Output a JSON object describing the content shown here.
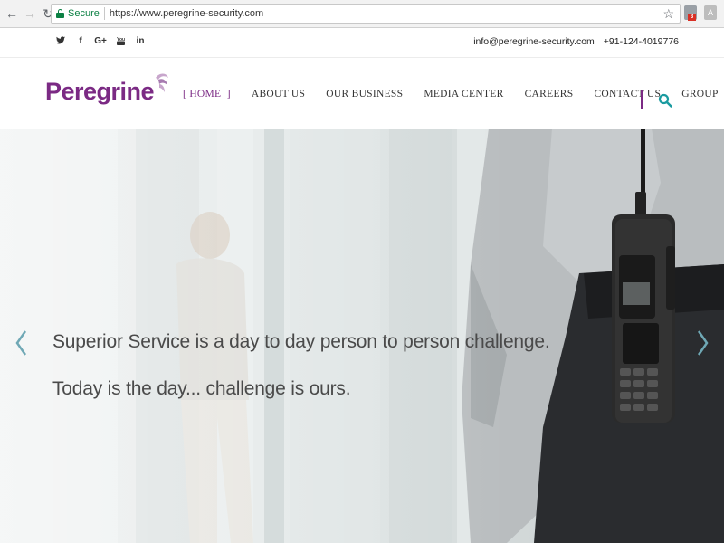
{
  "browser": {
    "secure_label": "Secure",
    "url": "https://www.peregrine-security.com",
    "mail_badge": "3",
    "pdf_label": "A"
  },
  "social": [
    "twitter-icon",
    "facebook-icon",
    "google-plus-icon",
    "youtube-icon",
    "linkedin-icon"
  ],
  "social_glyphs": [
    "𝕥",
    "f",
    "G+",
    "▶",
    "in"
  ],
  "contact": {
    "email": "info@peregrine-security.com",
    "phone": "+91-124-4019776"
  },
  "logo": {
    "text": "Peregrine"
  },
  "nav": {
    "home": "HOME",
    "about": "ABOUT US",
    "business": "OUR BUSINESS",
    "media": "MEDIA CENTER",
    "careers": "CAREERS",
    "contact": "CONTACT US",
    "group": "GROUP"
  },
  "hero": {
    "line1": "Superior Service is a day to day person to person challenge.",
    "line2": "Today is the day... challenge is ours."
  },
  "colors": {
    "brand": "#7b2a84",
    "accent": "#1a9ba0",
    "secure": "#0b8043"
  }
}
